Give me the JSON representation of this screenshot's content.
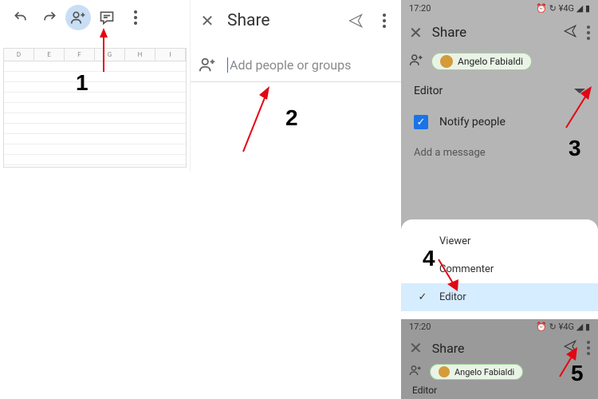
{
  "panel1": {
    "columns": [
      "D",
      "E",
      "F",
      "G",
      "H",
      "I"
    ]
  },
  "panel2": {
    "title": "Share",
    "placeholder": "Add people or groups"
  },
  "panel3": {
    "status_time": "17:20",
    "status_right": "⏰ ↻ ¥4G ◢ ▮",
    "title": "Share",
    "person": "Angelo Fabialdi",
    "role": "Editor",
    "notify": "Notify people",
    "message_ph": "Add a message"
  },
  "sheet": {
    "opt1": "Viewer",
    "opt2": "Commenter",
    "opt3": "Editor"
  },
  "panel5": {
    "status_time": "17:20",
    "status_right": "⏰ ↻ ¥4G ◢ ▮",
    "title": "Share",
    "person": "Angelo Fabialdi",
    "role": "Editor"
  },
  "labels": {
    "n1": "1",
    "n2": "2",
    "n3": "3",
    "n4": "4",
    "n5": "5"
  }
}
